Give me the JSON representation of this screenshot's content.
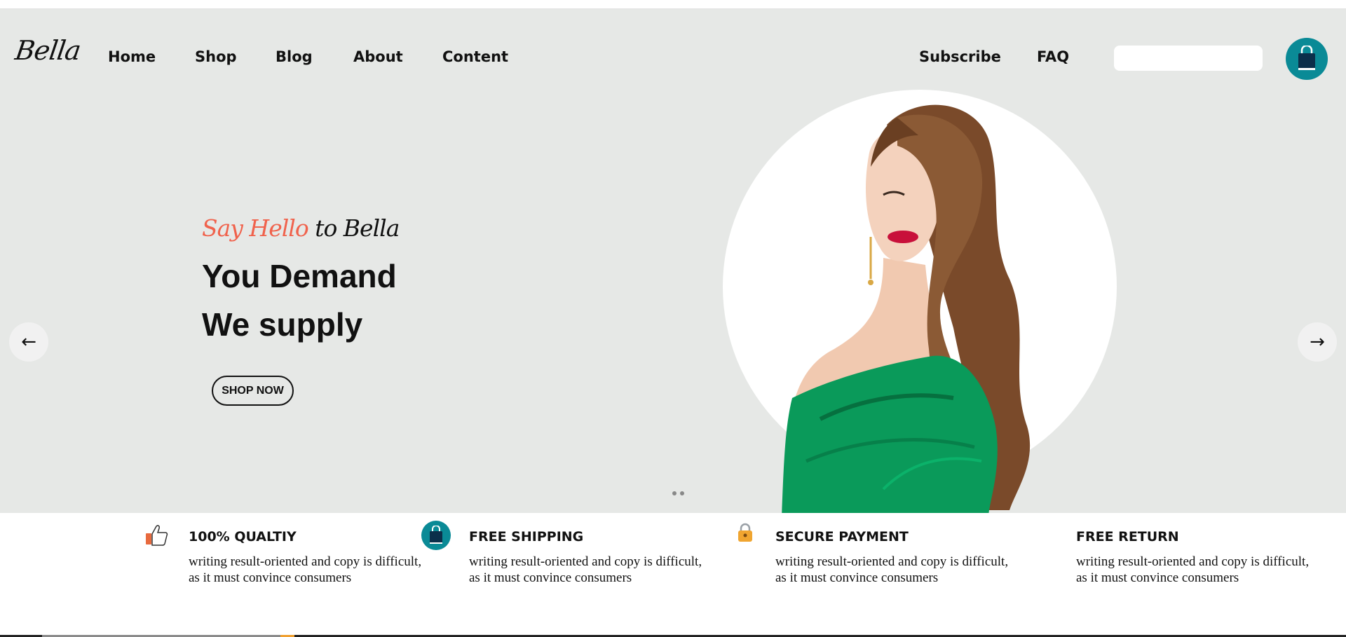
{
  "brand": {
    "logo": "Bella"
  },
  "nav": {
    "items": [
      {
        "label": "Home"
      },
      {
        "label": "Shop"
      },
      {
        "label": "Blog"
      },
      {
        "label": "About"
      },
      {
        "label": "Content"
      }
    ],
    "right_items": [
      {
        "label": "Subscribe"
      },
      {
        "label": "FAQ"
      }
    ],
    "search": {
      "value": "",
      "placeholder": ""
    },
    "cart_icon": "shopping-bag-icon"
  },
  "hero": {
    "tagline_accent": "Say Hello",
    "tagline_rest": " to Bella",
    "headline_line1": "You Demand",
    "headline_line2": "We supply",
    "cta_label": "SHOP NOW",
    "prev_arrow": "←",
    "next_arrow": "→",
    "slide_count": 2
  },
  "features": [
    {
      "icon": "thumbs-up-icon",
      "title": "100% QUALTIY",
      "text": "writing result-oriented and copy is difficult, as it must convince consumers"
    },
    {
      "icon": "shopping-bag-icon",
      "title": "FREE SHIPPING",
      "text": "writing result-oriented and copy is difficult, as it must convince consumers"
    },
    {
      "icon": "lock-icon",
      "title": "SECURE PAYMENT",
      "text": "writing result-oriented and copy is difficult, as it must convince consumers"
    },
    {
      "icon": "",
      "title": "FREE RETURN",
      "text": "writing result-oriented and copy is difficult, as it must convince consumers"
    }
  ],
  "colors": {
    "hero_bg": "#e6e8e6",
    "accent": "#f0624c",
    "teal": "#0a8a96",
    "dress_green": "#0a9a5a"
  }
}
